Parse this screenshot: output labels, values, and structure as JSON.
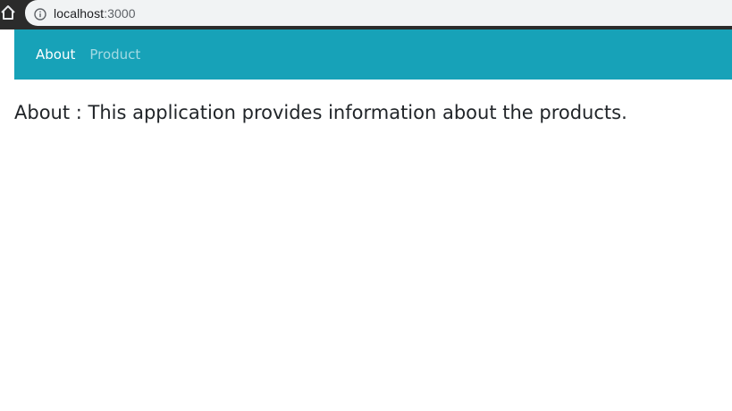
{
  "browser": {
    "url_host": "localhost",
    "url_port": ":3000",
    "icons": [
      "home-icon",
      "info-icon"
    ]
  },
  "navbar": {
    "bg_color": "#17a2b8",
    "links": [
      {
        "label": "About",
        "active": true
      },
      {
        "label": "Product",
        "active": false
      }
    ]
  },
  "main": {
    "heading": "About : This application provides information about the products."
  }
}
